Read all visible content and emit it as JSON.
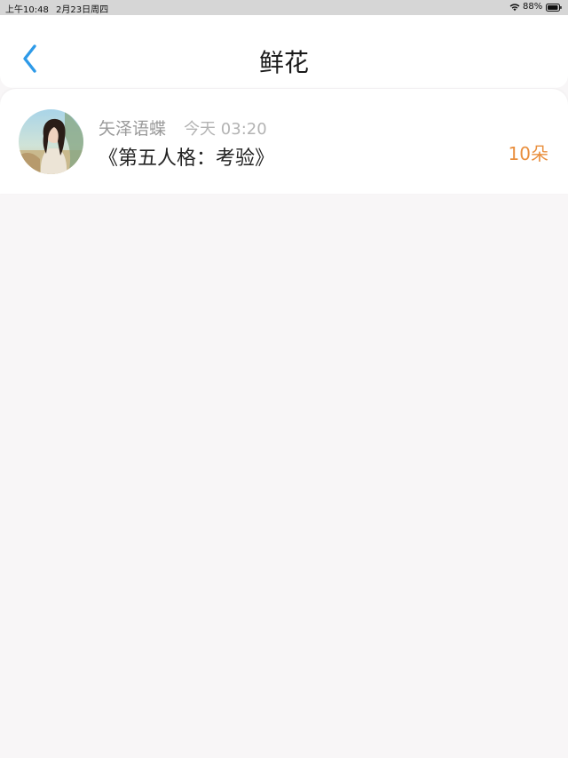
{
  "status_bar": {
    "time": "上午10:48",
    "date": "2月23日周四",
    "battery_percent": "88%",
    "wifi_icon": "wifi-icon",
    "battery_icon": "battery-icon"
  },
  "header": {
    "title": "鲜花",
    "back_icon": "chevron-left-icon"
  },
  "colors": {
    "accent_blue": "#2e9ae8",
    "count_orange": "#e98f3e"
  },
  "list": [
    {
      "username": "矢泽语蝶",
      "timestamp": "今天 03:20",
      "work_title": "《第五人格：考验》",
      "count": "10朵"
    }
  ]
}
